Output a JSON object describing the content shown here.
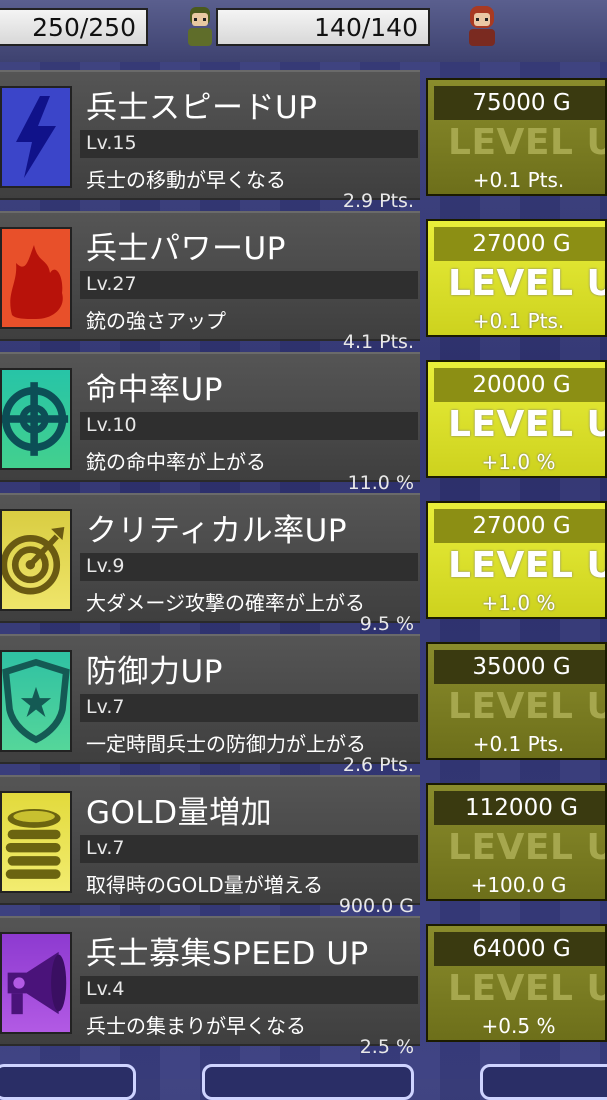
{
  "header": {
    "left_hp": "250/250",
    "right_hp": "140/140"
  },
  "upgrades": [
    {
      "title": "兵士スピードUP",
      "level": "Lv.15",
      "value": "2.9 Pts.",
      "desc": "兵士の移動が早くなる",
      "cost": "75000 G",
      "button": "LEVEL UP",
      "increment": "+0.1 Pts.",
      "state": "disabled",
      "icon": "lightning-bolt-icon",
      "icon_bg": "#3b45c9"
    },
    {
      "title": "兵士パワーUP",
      "level": "Lv.27",
      "value": "4.1 Pts.",
      "desc": "銃の強さアップ",
      "cost": "27000 G",
      "button": "LEVEL UP",
      "increment": "+0.1 Pts.",
      "state": "enabled",
      "icon": "flame-icon",
      "icon_bg": "#e8502a"
    },
    {
      "title": "命中率UP",
      "level": "Lv.10",
      "value": "11.0 %",
      "desc": "銃の命中率が上がる",
      "cost": "20000 G",
      "button": "LEVEL UP",
      "increment": "+1.0 %",
      "state": "enabled",
      "icon": "crosshair-icon",
      "icon_bg": "#2fc4a0"
    },
    {
      "title": "クリティカル率UP",
      "level": "Lv.9",
      "value": "9.5 %",
      "desc": "大ダメージ攻撃の確率が上がる",
      "cost": "27000 G",
      "button": "LEVEL UP",
      "increment": "+1.0 %",
      "state": "enabled",
      "icon": "target-dart-icon",
      "icon_bg": "#e8dc52"
    },
    {
      "title": "防御力UP",
      "level": "Lv.7",
      "value": "2.6 Pts.",
      "desc": "一定時間兵士の防御力が上がる",
      "cost": "35000 G",
      "button": "LEVEL UP",
      "increment": "+0.1 Pts.",
      "state": "disabled",
      "icon": "shield-star-icon",
      "icon_bg": "#3fc7a4"
    },
    {
      "title": "GOLD量増加",
      "level": "Lv.7",
      "value": "900.0 G",
      "desc": "取得時のGOLD量が増える",
      "cost": "112000 G",
      "button": "LEVEL UP",
      "increment": "+100.0 G",
      "state": "disabled",
      "icon": "coin-stack-icon",
      "icon_bg": "#e6e04a"
    },
    {
      "title": "兵士募集SPEED UP",
      "level": "Lv.4",
      "value": "2.5 %",
      "desc": "兵士の集まりが早くなる",
      "cost": "64000 G",
      "button": "LEVEL UP",
      "increment": "+0.5 %",
      "state": "disabled",
      "icon": "megaphone-icon",
      "icon_bg": "#9a44d6"
    }
  ]
}
